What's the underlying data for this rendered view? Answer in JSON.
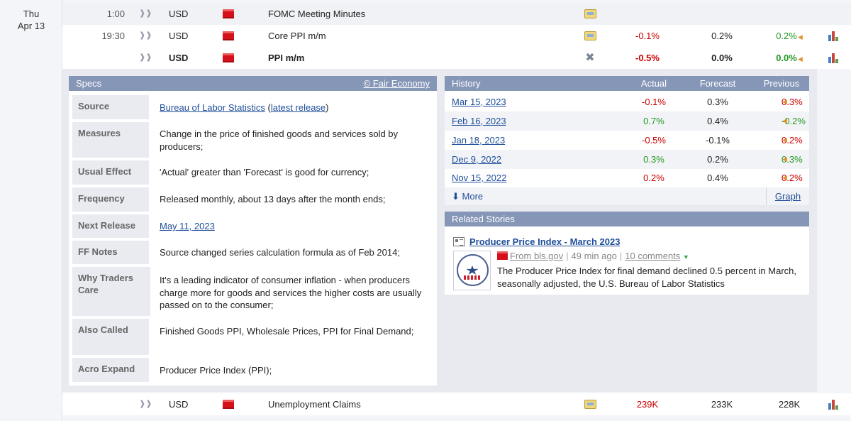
{
  "date": {
    "weekday": "Thu",
    "day": "Apr 13"
  },
  "rows": [
    {
      "time": "1:00",
      "currency": "USD",
      "event": "FOMC Meeting Minutes",
      "actual": "",
      "forecast": "",
      "previous": ""
    },
    {
      "time": "19:30",
      "currency": "USD",
      "event": "Core PPI m/m",
      "actual": "-0.1%",
      "forecast": "0.2%",
      "previous": "0.2%"
    },
    {
      "time": "",
      "currency": "USD",
      "event": "PPI m/m",
      "actual": "-0.5%",
      "forecast": "0.0%",
      "previous": "0.0%"
    },
    {
      "time": "",
      "currency": "USD",
      "event": "Unemployment Claims",
      "actual": "239K",
      "forecast": "233K",
      "previous": "228K"
    }
  ],
  "specs": {
    "title": "Specs",
    "copyright": "© Fair Economy",
    "source_label": "Source",
    "source_link": "Bureau of Labor Statistics",
    "source_open": "(",
    "source_latest": "latest release",
    "source_close": ")",
    "measures_label": "Measures",
    "measures": "Change in the price of finished goods and services sold by producers;",
    "usual_label": "Usual Effect",
    "usual": "'Actual' greater than 'Forecast' is good for currency;",
    "freq_label": "Frequency",
    "freq": "Released monthly, about 13 days after the month ends;",
    "next_label": "Next Release",
    "next": "May 11, 2023",
    "ff_label": "FF Notes",
    "ff": "Source changed series calculation formula as of Feb 2014;",
    "why_label": "Why Traders Care",
    "why": "It's a leading indicator of consumer inflation - when producers charge more for goods and services the higher costs are usually passed on to the consumer;",
    "also_label": "Also Called",
    "also": "Finished Goods PPI, Wholesale Prices, PPI for Final Demand;",
    "acro_label": "Acro Expand",
    "acro": "Producer Price Index (PPI);"
  },
  "history": {
    "title": "History",
    "col_actual": "Actual",
    "col_forecast": "Forecast",
    "col_previous": "Previous",
    "rows": [
      {
        "date": "Mar 15, 2023",
        "actual": "-0.1%",
        "forecast": "0.3%",
        "previous": "0.3%"
      },
      {
        "date": "Feb 16, 2023",
        "actual": "0.7%",
        "forecast": "0.4%",
        "previous": "-0.2%"
      },
      {
        "date": "Jan 18, 2023",
        "actual": "-0.5%",
        "forecast": "-0.1%",
        "previous": "0.2%"
      },
      {
        "date": "Dec 9, 2022",
        "actual": "0.3%",
        "forecast": "0.2%",
        "previous": "0.3%"
      },
      {
        "date": "Nov 15, 2022",
        "actual": "0.2%",
        "forecast": "0.4%",
        "previous": "0.2%"
      }
    ],
    "more": "More",
    "graph": "Graph"
  },
  "related": {
    "title": "Related Stories",
    "story_title": "Producer Price Index - March 2023",
    "source": "From bls.gov",
    "age": "49 min ago",
    "comments": "10 comments",
    "snippet": "The Producer Price Index for final demand declined 0.5 percent in March, seasonally adjusted, the U.S. Bureau of Labor Statistics"
  },
  "colors": {
    "negative": "#cc0000",
    "positive": "#229922",
    "header": "#8596b7",
    "link": "#1f4e9a"
  }
}
